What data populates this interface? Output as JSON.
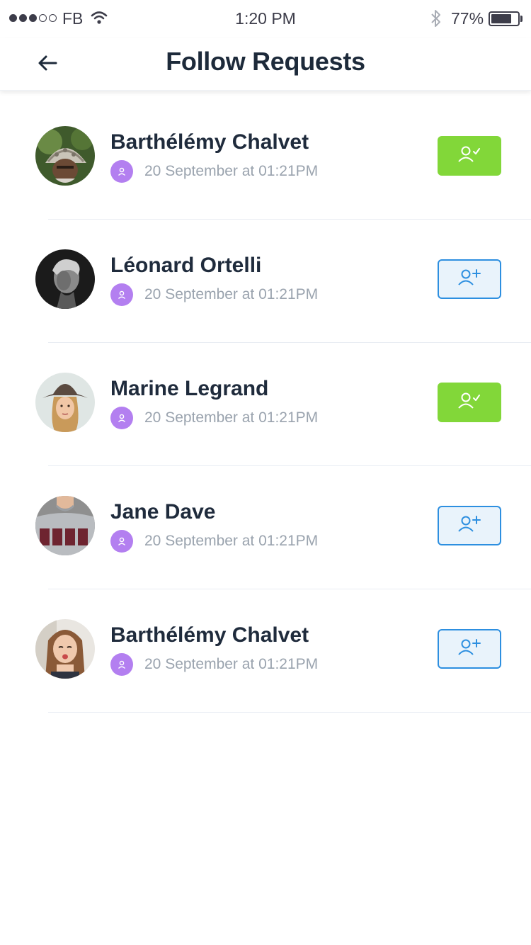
{
  "status_bar": {
    "carrier": "FB",
    "time": "1:20 PM",
    "battery_percent": "77%",
    "battery_level": 0.77,
    "signal_bars": 3,
    "signal_total": 5
  },
  "header": {
    "title": "Follow Requests",
    "back_icon": "arrow-left-icon"
  },
  "colors": {
    "accepted": "#82d739",
    "pending_border": "#2d8fe0",
    "pending_bg": "#e9f3fb",
    "badge": "#b37ff0"
  },
  "requests": [
    {
      "name": "Barthélémy Chalvet",
      "time": "20 September at 01:21PM",
      "status": "accepted",
      "action_icon": "user-check-icon"
    },
    {
      "name": "Léonard Ortelli",
      "time": "20 September at 01:21PM",
      "status": "pending",
      "action_icon": "user-plus-icon"
    },
    {
      "name": "Marine Legrand",
      "time": "20 September at 01:21PM",
      "status": "accepted",
      "action_icon": "user-check-icon"
    },
    {
      "name": "Jane Dave",
      "time": "20 September at 01:21PM",
      "status": "pending",
      "action_icon": "user-plus-icon"
    },
    {
      "name": "Barthélémy Chalvet",
      "time": "20 September at 01:21PM",
      "status": "pending",
      "action_icon": "user-plus-icon"
    }
  ]
}
